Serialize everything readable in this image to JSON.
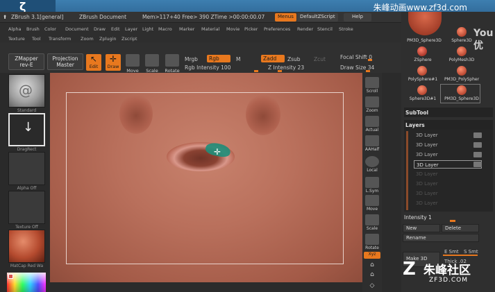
{
  "watermark": {
    "top_right": "朱峰动画www.zf3d.com",
    "bottom_right_main": "朱峰社区",
    "bottom_right_url": "ZF3D.COM",
    "edge_right": "You\n优"
  },
  "titlebar": {
    "app": "ZBrush 3.1[general]",
    "doc": "ZBrush Document",
    "mem": "Mem>117+40 Free> 390 ZTime >00:00:00.07",
    "menus_button": "Menus",
    "defaultzscript_button": "DefaultZScript",
    "help_button": "Help"
  },
  "menu": {
    "row1": [
      "Alpha",
      "Brush",
      "Color",
      "Document",
      "Draw",
      "Edit",
      "Layer",
      "Light",
      "Macro",
      "Marker",
      "Material",
      "Movie",
      "Picker",
      "Preferences",
      "Render",
      "Stencil",
      "Stroke"
    ],
    "row2": [
      "Texture",
      "Tool",
      "Transform",
      "Zoom",
      "Zplugin",
      "Zscript"
    ]
  },
  "toolbar": {
    "zmapper_label": "ZMapper",
    "zmapper_sub": "rev-E",
    "projection_label": "Projection",
    "projection_sub": "Master",
    "edit": "Edit",
    "draw": "Draw",
    "move": "Move",
    "scale": "Scale",
    "rotate": "Rotate",
    "mrgb": "Mrgb",
    "rgb": "Rgb",
    "m": "M",
    "rgb_intensity": "Rgb Intensity 100",
    "zadd": "Zadd",
    "zsub": "Zsub",
    "zcut": "Zcut",
    "z_intensity": "Z Intensity 23",
    "focal_shift": "Focal Shift 0",
    "draw_size": "Draw Size 34"
  },
  "left_panel": {
    "brush_label": "Standard",
    "stroke_label": "DragRect",
    "alpha_label": "Alpha Off",
    "texture_label": "Texture Off",
    "material_label": "MatCap Red Wa"
  },
  "right_strip": [
    "Scroll",
    "Zoom",
    "Actual",
    "AAHalf",
    "Local",
    "L.Sym",
    "Move",
    "Scale",
    "Rotate",
    "Xyz"
  ],
  "tool_palette": {
    "items": [
      "PM3D_Sphere3D",
      "Sphere3D",
      "ZSphere",
      "PolyMesh3D",
      "PolySphere#1",
      "PM3D_PolySpher",
      "Sphere3D#1",
      "PM3D_Sphere3D"
    ],
    "subtool": "SubTool",
    "layers_title": "Layers",
    "layers": [
      "3D Layer",
      "3D Layer",
      "3D Layer",
      "3D Layer",
      "3D Layer",
      "3D Layer",
      "3D Layer",
      "3D Layer"
    ],
    "intensity": "Intensity 1",
    "new_button": "New",
    "delete_button": "Delete",
    "rename_button": "Rename",
    "make3d_button": "Make 3D",
    "e_smt": "E Smt",
    "s_smt": "S Smt",
    "thick": "Thick .02"
  },
  "colors": {
    "accent": "#e8781e",
    "canvas": "#b46a55",
    "panel": "#2e2e2e"
  }
}
